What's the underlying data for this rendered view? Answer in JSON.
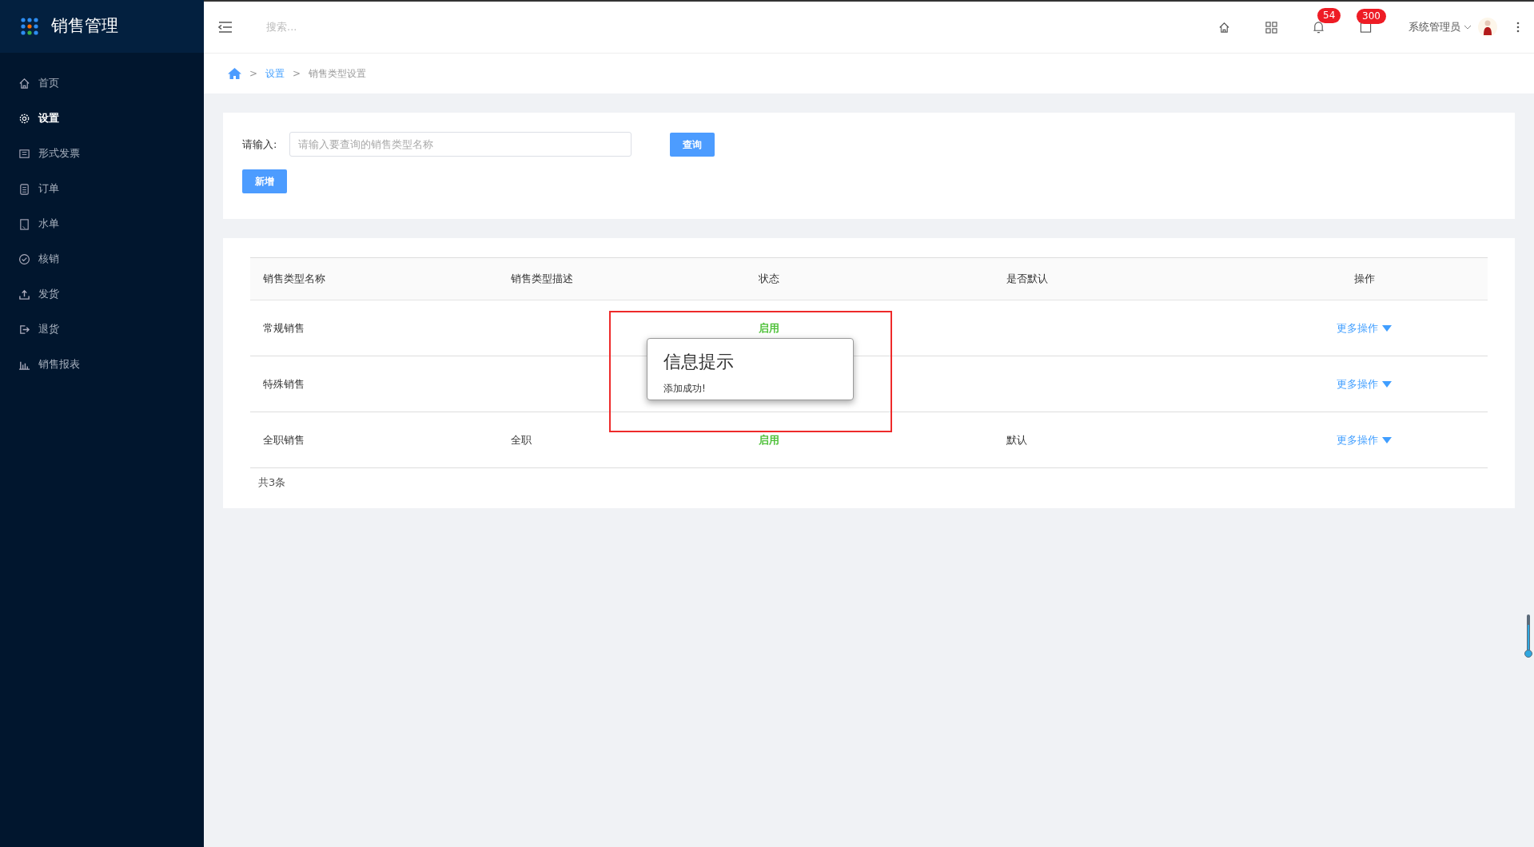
{
  "app_title": "销售管理",
  "sidebar": {
    "items": [
      {
        "label": "首页",
        "selected": false
      },
      {
        "label": "设置",
        "selected": true
      },
      {
        "label": "形式发票",
        "selected": false
      },
      {
        "label": "订单",
        "selected": false
      },
      {
        "label": "水单",
        "selected": false
      },
      {
        "label": "核销",
        "selected": false
      },
      {
        "label": "发货",
        "selected": false
      },
      {
        "label": "退货",
        "selected": false
      },
      {
        "label": "销售报表",
        "selected": false
      }
    ]
  },
  "topbar": {
    "search_placeholder": "搜索...",
    "notifications_badge": "54",
    "messages_badge": "300",
    "user": "系统管理员"
  },
  "breadcrumb": [
    {
      "separator": ">",
      "label": "设置",
      "link": true
    },
    {
      "separator": ">",
      "label": "销售类型设置",
      "link": false
    }
  ],
  "search": {
    "label": "请输入:",
    "placeholder": "请输入要查询的销售类型名称",
    "query_button": "查询",
    "add_button": "新增"
  },
  "table": {
    "columns": [
      "销售类型名称",
      "销售类型描述",
      "状态",
      "是否默认",
      "操作"
    ],
    "rows": [
      {
        "name": "常规销售",
        "status": "启用",
        "action": "更多操作"
      },
      {
        "name": "特殊销售",
        "action": "更多操作"
      },
      {
        "name": "全职销售",
        "description": "全职",
        "status": "启用",
        "default": "默认",
        "action": "更多操作"
      }
    ],
    "total": "共3条"
  },
  "dialog": {
    "title": "信息提示",
    "message": "添加成功!"
  }
}
